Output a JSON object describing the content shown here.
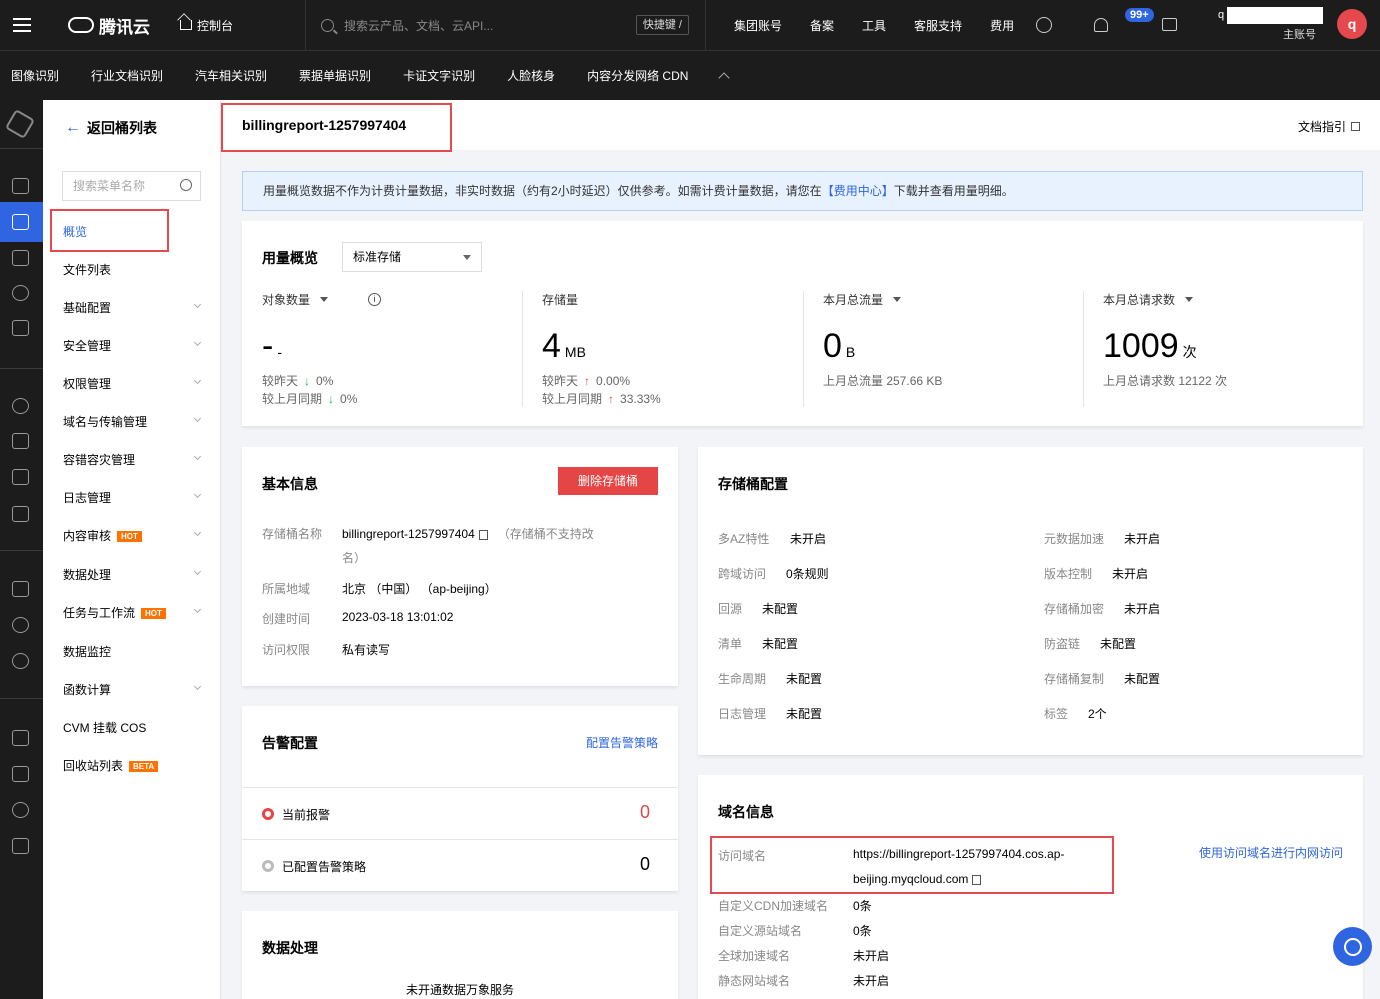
{
  "topbar": {
    "brand": "腾讯云",
    "console": "控制台",
    "search_placeholder": "搜索云产品、文档、云API...",
    "shortcut": "快捷键 /",
    "links": [
      "集团账号",
      "备案",
      "工具",
      "客服支持",
      "费用"
    ],
    "notification_count": "99+",
    "account_prefix": "q",
    "account_role": "主账号",
    "avatar_letter": "q"
  },
  "subnav": [
    "图像识别",
    "行业文档识别",
    "汽车相关识别",
    "票据单据识别",
    "卡证文字识别",
    "人脸核身",
    "内容分发网络 CDN"
  ],
  "sidebar": {
    "back_label": "返回桶列表",
    "search_placeholder": "搜索菜单名称",
    "items": [
      {
        "label": "概览"
      },
      {
        "label": "文件列表"
      },
      {
        "label": "基础配置"
      },
      {
        "label": "安全管理"
      },
      {
        "label": "权限管理"
      },
      {
        "label": "域名与传输管理"
      },
      {
        "label": "容错容灾管理"
      },
      {
        "label": "日志管理"
      },
      {
        "label": "内容审核",
        "tag": "HOT"
      },
      {
        "label": "数据处理"
      },
      {
        "label": "任务与工作流",
        "tag": "HOT"
      },
      {
        "label": "数据监控"
      },
      {
        "label": "函数计算"
      },
      {
        "label": "CVM 挂载 COS"
      },
      {
        "label": "回收站列表",
        "tag": "BETA"
      }
    ]
  },
  "header": {
    "bucket_name": "billingreport-1257997404",
    "doc_link": "文档指引"
  },
  "notice": {
    "text_before": "用量概览数据不作为计费计量数据，非实时数据（约有2小时延迟）仅供参考。如需计费计量数据，请您在",
    "link": "【费用中心】",
    "text_after": "下载并查看用量明细。"
  },
  "usage": {
    "title": "用量概览",
    "storage_type": "标准存储",
    "metrics": [
      {
        "label": "对象数量",
        "value": "-",
        "unit": "-",
        "line1_label": "较昨天",
        "line1_value": "0%",
        "line2_label": "较上月同期",
        "line2_value": "0%"
      },
      {
        "label": "存储量",
        "value": "4",
        "unit": "MB",
        "line1_label": "较昨天",
        "line1_value": "0.00%",
        "line2_label": "较上月同期",
        "line2_value": "33.33%"
      },
      {
        "label": "本月总流量",
        "value": "0",
        "unit": "B",
        "line1_label": "上月总流量 257.66 KB"
      },
      {
        "label": "本月总请求数",
        "value": "1009",
        "unit": "次",
        "line1_label": "上月总请求数 12122 次"
      }
    ]
  },
  "basic": {
    "title": "基本信息",
    "delete_btn": "删除存储桶",
    "rows": [
      {
        "k": "存储桶名称",
        "v": "billingreport-1257997404",
        "note": "（存储桶不支持改",
        "note2": "名）"
      },
      {
        "k": "所属地域",
        "v": "北京 （中国） （ap-beijing）"
      },
      {
        "k": "创建时间",
        "v": "2023-03-18 13:01:02"
      },
      {
        "k": "访问权限",
        "v": "私有读写"
      }
    ]
  },
  "alert": {
    "title": "告警配置",
    "link": "配置告警策略",
    "rows": [
      {
        "label": "当前报警",
        "value": "0"
      },
      {
        "label": "已配置告警策略",
        "value": "0"
      }
    ]
  },
  "dataproc": {
    "title": "数据处理",
    "text": "未开通数据万象服务"
  },
  "bucketcfg": {
    "title": "存储桶配置",
    "left": [
      {
        "k": "多AZ特性",
        "v": "未开启"
      },
      {
        "k": "跨域访问",
        "v": "0条规则"
      },
      {
        "k": "回源",
        "v": "未配置"
      },
      {
        "k": "清单",
        "v": "未配置"
      },
      {
        "k": "生命周期",
        "v": "未配置"
      },
      {
        "k": "日志管理",
        "v": "未配置"
      }
    ],
    "right": [
      {
        "k": "元数据加速",
        "v": "未开启"
      },
      {
        "k": "版本控制",
        "v": "未开启"
      },
      {
        "k": "存储桶加密",
        "v": "未开启"
      },
      {
        "k": "防盗链",
        "v": "未配置"
      },
      {
        "k": "存储桶复制",
        "v": "未配置"
      },
      {
        "k": "标签",
        "v": "2个"
      }
    ]
  },
  "domain": {
    "title": "域名信息",
    "access_label": "访问域名",
    "access_line1": "https://billingreport-1257997404.cos.ap-",
    "access_line2": "beijing.myqcloud.com",
    "intranet_link": "使用访问域名进行内网访问",
    "rows": [
      {
        "k": "自定义CDN加速域名",
        "v": "0条"
      },
      {
        "k": "自定义源站域名",
        "v": "0条"
      },
      {
        "k": "全球加速域名",
        "v": "未开启"
      },
      {
        "k": "静态网站域名",
        "v": "未开启"
      }
    ]
  }
}
